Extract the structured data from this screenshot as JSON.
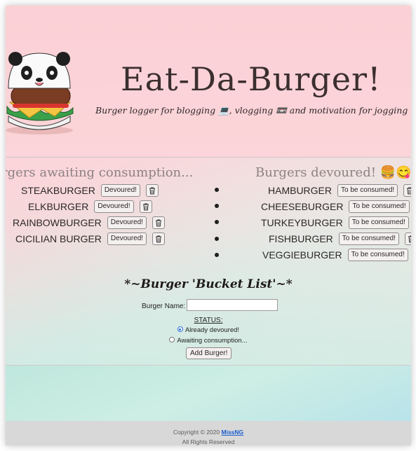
{
  "header": {
    "title": "Eat-Da-Burger!",
    "subtitle": "Burger logger for blogging 💻, vlogging 📼 and motivation for jogging 🏃"
  },
  "awaiting": {
    "heading": "rgers awaiting consumption...",
    "button_label": "Devoured!",
    "items": [
      "STEAKBURGER",
      "ELKBURGER",
      "RAINBOWBURGER",
      "CICILIAN BURGER"
    ]
  },
  "devoured": {
    "heading": "Burgers devoured! 🍔😋",
    "button_label": "To be consumed!",
    "items": [
      "HAMBURGER",
      "CHEESEBURGER",
      "TURKEYBURGER",
      "FISHBURGER",
      "VEGGIEBURGER"
    ]
  },
  "form": {
    "title": "*~Burger 'Bucket List'~*",
    "name_label": "Burger Name:",
    "name_value": "",
    "status_label": "STATUS:",
    "option_devoured": "Already devoured!",
    "option_awaiting": "Awaiting consumption...",
    "selected": "devoured",
    "submit_label": "Add Burger!"
  },
  "footer": {
    "copyright_prefix": "Copyright © 2020",
    "author": "MissNG",
    "rights": "All Rights Reserved"
  },
  "colors": {
    "header_bg": "#fbd0d6",
    "footer_bg": "#d8d8d8",
    "link": "#1a5bd0"
  }
}
